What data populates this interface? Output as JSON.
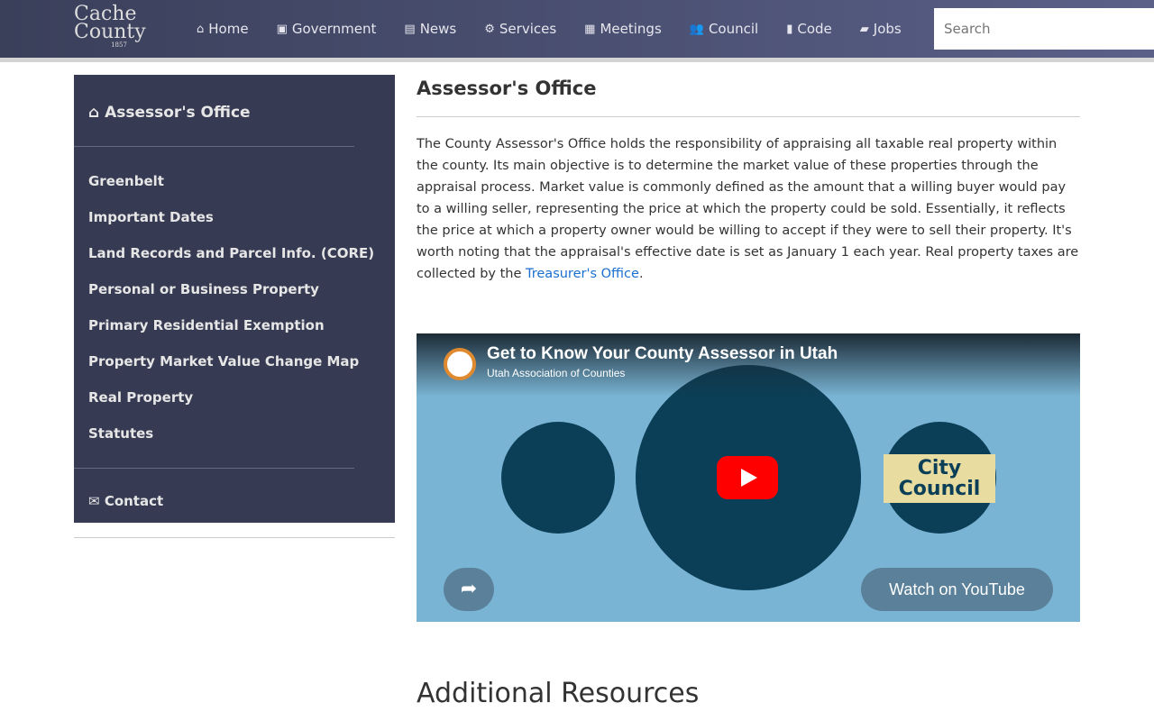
{
  "header": {
    "logo_text": "Cache County",
    "logo_year": "1857",
    "menu": [
      {
        "label": "Home",
        "icon": "home-icon"
      },
      {
        "label": "Government",
        "icon": "address-book-icon"
      },
      {
        "label": "News",
        "icon": "newspaper-icon"
      },
      {
        "label": "Services",
        "icon": "gear-icon"
      },
      {
        "label": "Meetings",
        "icon": "calendar-icon"
      },
      {
        "label": "Council",
        "icon": "users-icon"
      },
      {
        "label": "Code",
        "icon": "book-icon"
      },
      {
        "label": "Jobs",
        "icon": "briefcase-icon"
      }
    ],
    "search_placeholder": "Search"
  },
  "sidebar": {
    "title": "Assessor's Office",
    "items": [
      "Greenbelt",
      "Important Dates",
      "Land Records and Parcel Info. (CORE)",
      "Personal or Business Property",
      "Primary Residential Exemption",
      "Property Market Value Change Map",
      "Real Property",
      "Statutes"
    ],
    "contact": "Contact"
  },
  "main": {
    "title": "Assessor's Office",
    "body": "The County Assessor's Office holds the responsibility of appraising all taxable real property within the county. Its main objective is to determine the market value of these properties through the appraisal process. Market value is commonly defined as the amount that a willing buyer would pay to a willing seller, representing the price at which the property could be sold. Essentially, it reflects the price at which a property owner would be willing to accept if they were to sell their property. It's worth noting that the appraisal's effective date is set as January 1 each year.  Real property taxes are collected by the ",
    "link": "Treasurer's Office",
    "after_link": ".",
    "video": {
      "title": "Get to Know Your County Assessor in Utah",
      "channel": "Utah Association of Counties",
      "badge": "City Council",
      "watch": "Watch on YouTube"
    },
    "additional": "Additional Resources"
  }
}
